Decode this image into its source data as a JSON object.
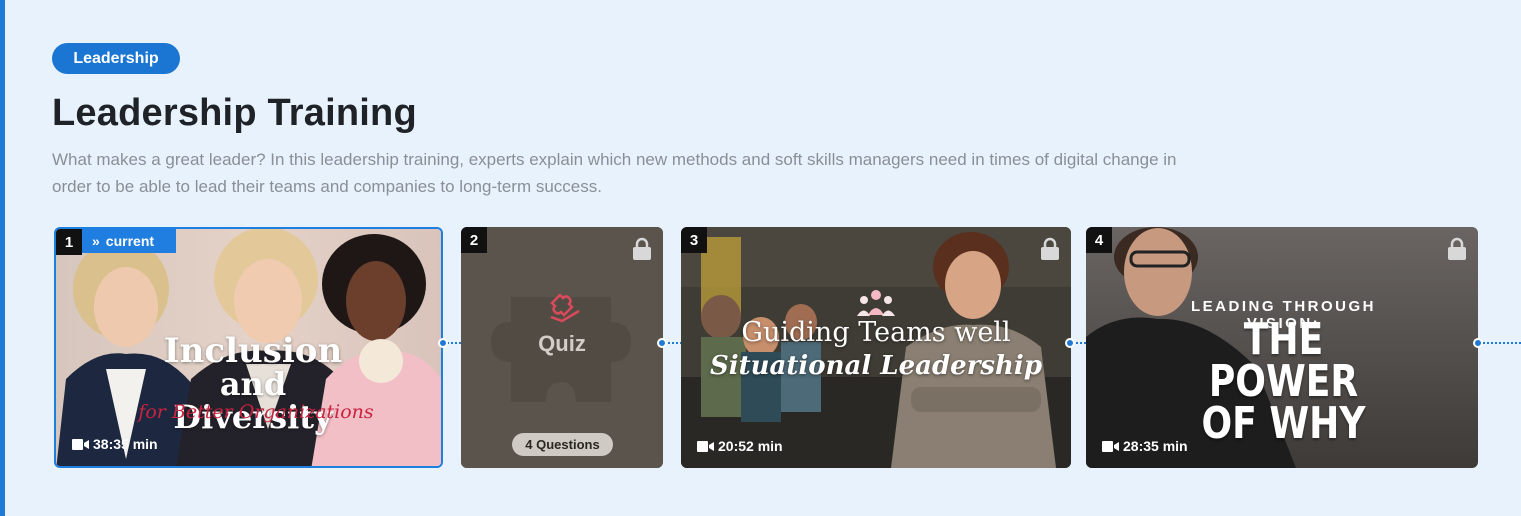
{
  "course": {
    "category": "Leadership",
    "title": "Leadership Training",
    "description": "What makes a great leader? In this leadership training, experts explain which new methods and soft skills managers need in times of digital change in order to be able to lead their teams and companies to long-term success."
  },
  "cards": [
    {
      "number": "1",
      "current_label": "current",
      "title_line1": "Inclusion",
      "title_line2": "and Diversity",
      "subtitle": "for Better Organizations",
      "duration": "38:35 min",
      "icon": "video-camera-icon"
    },
    {
      "number": "2",
      "label": "Quiz",
      "questions": "4 Questions",
      "icon": "lock-icon"
    },
    {
      "number": "3",
      "title_line1": "Guiding Teams well",
      "title_line2": "Situational Leadership",
      "duration": "20:52 min",
      "icon": "lock-icon"
    },
    {
      "number": "4",
      "kicker": "LEADING THROUGH VISION:",
      "title_line1": "THE POWER",
      "title_line2": "OF WHY",
      "duration": "28:35 min",
      "icon": "lock-icon"
    }
  ],
  "colors": {
    "accent": "#1f7ad6",
    "background": "#e8f2fc"
  }
}
